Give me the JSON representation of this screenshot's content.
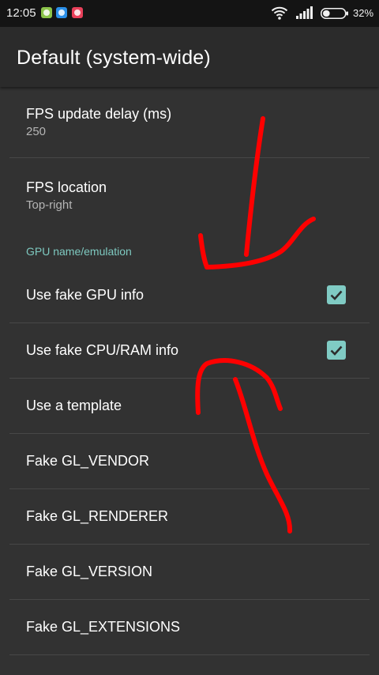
{
  "status_bar": {
    "time": "12:05",
    "battery_percent": "32%",
    "battery_level": 0.32,
    "icons": [
      "notification-app-icon-green",
      "notification-app-icon-blue",
      "notification-app-icon-red",
      "wifi-icon",
      "signal-icon",
      "battery-icon"
    ]
  },
  "toolbar": {
    "title": "Default (system-wide)"
  },
  "colors": {
    "accent": "#80cbc4",
    "category_text": "#7ec9c0",
    "background": "#323232",
    "annotation": "#ff0000"
  },
  "preferences": {
    "fps_delay": {
      "title": "FPS update delay (ms)",
      "summary": "250"
    },
    "fps_location": {
      "title": "FPS location",
      "summary": "Top-right"
    },
    "category_gpu": "GPU name/emulation",
    "fake_gpu": {
      "title": "Use fake GPU info",
      "checked": true
    },
    "fake_cpu_ram": {
      "title": "Use fake CPU/RAM info",
      "checked": true
    },
    "template": {
      "title": "Use a template"
    },
    "gl_vendor": {
      "title": "Fake GL_VENDOR"
    },
    "gl_renderer": {
      "title": "Fake GL_RENDERER"
    },
    "gl_version": {
      "title": "Fake GL_VERSION"
    },
    "gl_extensions": {
      "title": "Fake GL_EXTENSIONS"
    }
  }
}
